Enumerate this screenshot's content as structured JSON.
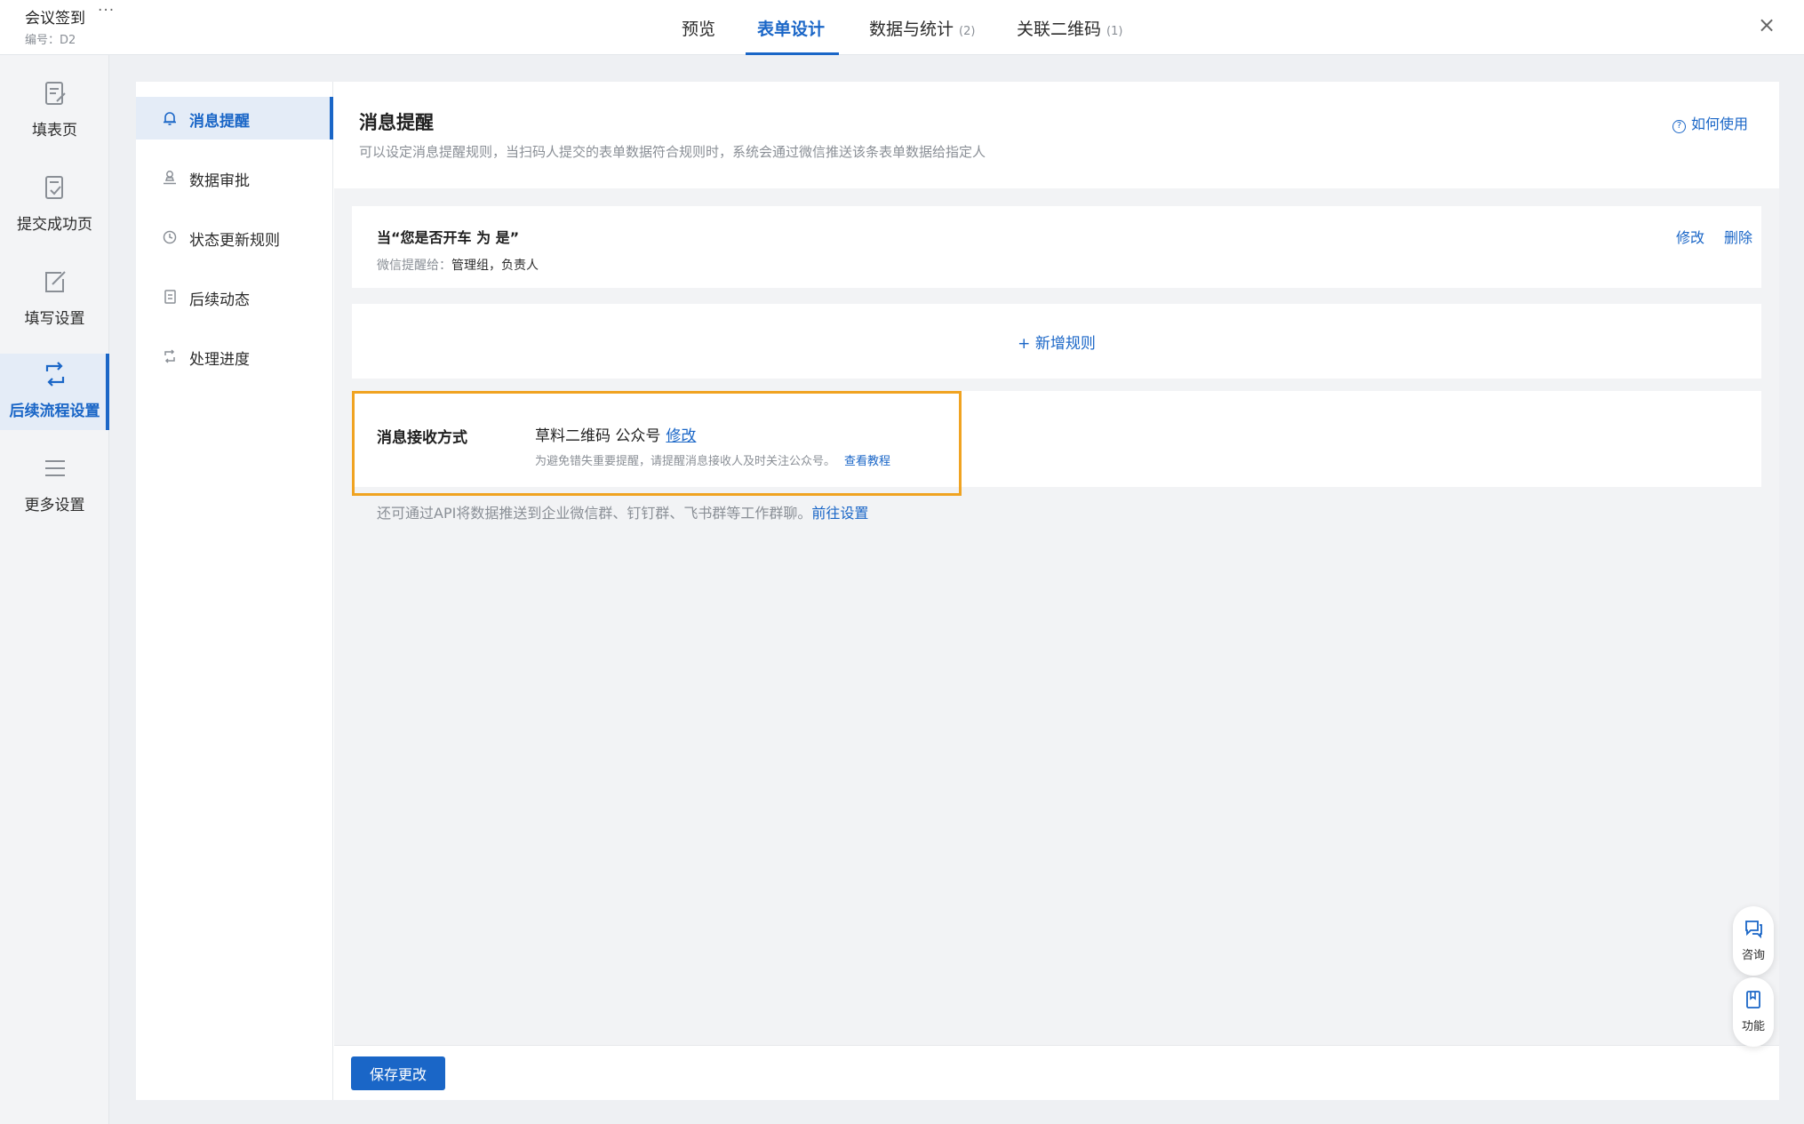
{
  "app": {
    "title": "会议签到",
    "more": "···",
    "code": "编号：D2"
  },
  "tabs": [
    {
      "label": "预览",
      "count": ""
    },
    {
      "label": "表单设计",
      "count": ""
    },
    {
      "label": "数据与统计",
      "count": "(2)"
    },
    {
      "label": "关联二维码",
      "count": "(1)"
    }
  ],
  "close": "×",
  "rail": [
    {
      "label": "填表页",
      "icon": "form-page-icon"
    },
    {
      "label": "提交成功页",
      "icon": "submit-success-icon"
    },
    {
      "label": "填写设置",
      "icon": "edit-settings-icon"
    },
    {
      "label": "后续流程设置",
      "icon": "workflow-icon"
    },
    {
      "label": "更多设置",
      "icon": "menu-icon"
    }
  ],
  "subnav": [
    {
      "label": "消息提醒",
      "icon": "bell-icon"
    },
    {
      "label": "数据审批",
      "icon": "stamp-icon"
    },
    {
      "label": "状态更新规则",
      "icon": "clock-icon"
    },
    {
      "label": "后续动态",
      "icon": "document-icon"
    },
    {
      "label": "处理进度",
      "icon": "progress-icon"
    }
  ],
  "header": {
    "title": "消息提醒",
    "desc": "可以设定消息提醒规则，当扫码人提交的表单数据符合规则时，系统会通过微信推送该条表单数据给指定人",
    "help": "如何使用"
  },
  "rule": {
    "title": "当“您是否开车 为 是”",
    "sub_prefix": "微信提醒给：",
    "sub_value": "管理组，负责人",
    "edit": "修改",
    "delete": "删除"
  },
  "add_rule": "+ 新增规则",
  "receive": {
    "label": "消息接收方式",
    "value": "草料二维码 公众号",
    "edit": "修改",
    "tip": "为避免错失重要提醒，请提醒消息接收人及时关注公众号。",
    "tutorial": "查看教程"
  },
  "api_note": {
    "text": "还可通过API将数据推送到企业微信群、钉钉群、飞书群等工作群聊。",
    "link": "前往设置"
  },
  "save_button": "保存更改",
  "float": {
    "consult": "咨询",
    "feature": "功能"
  },
  "colors": {
    "accent": "#1a66c7",
    "highlight": "#f0a321"
  }
}
